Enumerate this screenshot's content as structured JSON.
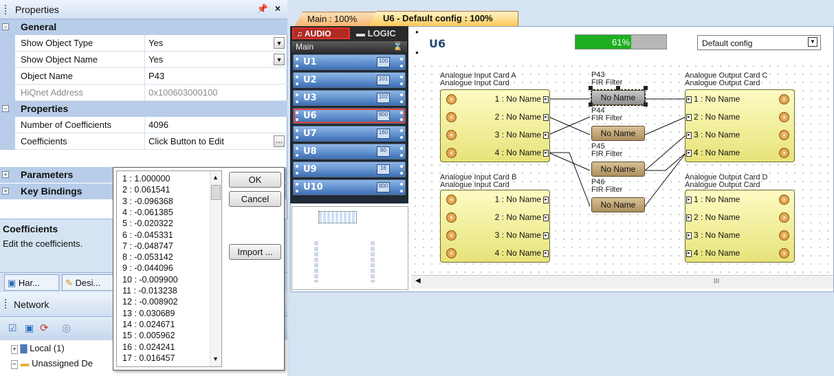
{
  "properties_panel": {
    "title": "Properties",
    "pin_glyph": "ѱ",
    "close_glyph": "×",
    "categories": {
      "general": "General",
      "properties": "Properties",
      "parameters": "Parameters",
      "key_bindings": "Key Bindings"
    },
    "rows": {
      "show_object_type": {
        "label": "Show Object Type",
        "value": "Yes"
      },
      "show_object_name": {
        "label": "Show Object Name",
        "value": "Yes"
      },
      "object_name": {
        "label": "Object Name",
        "value": "P43"
      },
      "hiqnet_address": {
        "label": "HiQnet Address",
        "value": "0x100603000100"
      },
      "num_coefficients": {
        "label": "Number of Coefficients",
        "value": "4096"
      },
      "coefficients": {
        "label": "Coefficients",
        "value": "Click Button to Edit",
        "button": "..."
      }
    },
    "description": {
      "title": "Coefficients",
      "text": "Edit the coefficients."
    },
    "tabs": [
      "Har...",
      "Desi..."
    ]
  },
  "network_panel": {
    "title": "Network",
    "tree": [
      "Local (1)",
      "Unassigned De"
    ]
  },
  "coefficients_popup": {
    "items": [
      "1 : 1.000000",
      "2 : 0.061541",
      "3 : -0.096368",
      "4 : -0.061385",
      "5 : -0.020322",
      "6 : -0.045331",
      "7 : -0.048747",
      "8 : -0.053142",
      "9 : -0.044096",
      "10 : -0.009900",
      "11 : -0.013238",
      "12 : -0.008902",
      "13 : 0.030689",
      "14 : 0.024671",
      "15 : 0.005962",
      "16 : 0.024241",
      "17 : 0.016457"
    ],
    "ok": "OK",
    "cancel": "Cancel",
    "import": "Import ..."
  },
  "document_tabs": [
    "Main : 100%",
    "U6 - Default config : 100%"
  ],
  "device_panel": {
    "audio": "AUDIO",
    "logic": "LOGIC",
    "main": "Main",
    "devices": [
      {
        "name": "U1",
        "badge": "100"
      },
      {
        "name": "U2",
        "badge": "101"
      },
      {
        "name": "U3",
        "badge": "102"
      },
      {
        "name": "U6",
        "badge": "800"
      },
      {
        "name": "U7",
        "badge": "160"
      },
      {
        "name": "U8",
        "badge": "80"
      },
      {
        "name": "U9",
        "badge": "16"
      },
      {
        "name": "U10",
        "badge": "800"
      }
    ]
  },
  "designer": {
    "device": "U6",
    "progress": "61%",
    "progress_value": 0.61,
    "config": "Default config",
    "scroll_label": "III",
    "input_a": {
      "title": "Analogue Input Card A",
      "type": "Analogue Input Card",
      "ports": [
        "1 : No Name",
        "2 : No Name",
        "3 : No Name",
        "4 : No Name"
      ]
    },
    "input_b": {
      "title": "Analogue Input Card B",
      "type": "Analogue Input Card",
      "ports": [
        "1 : No Name",
        "2 : No Name",
        "3 : No Name",
        "4 : No Name"
      ]
    },
    "output_c": {
      "title": "Analogue Output Card C",
      "type": "Analogue Output Card",
      "ports": [
        "1 : No Name",
        "2 : No Name",
        "3 : No Name",
        "4 : No Name"
      ]
    },
    "output_d": {
      "title": "Analogue Output Card D",
      "type": "Analogue Output Card",
      "ports": [
        "1 : No Name",
        "2 : No Name",
        "3 : No Name",
        "4 : No Name"
      ]
    },
    "firs": [
      {
        "id": "P43",
        "type": "FIR Filter",
        "name": "No Name"
      },
      {
        "id": "P44",
        "type": "FIR Filter",
        "name": "No Name"
      },
      {
        "id": "P45",
        "type": "FIR Filter",
        "name": "No Name"
      },
      {
        "id": "P46",
        "type": "FIR Filter",
        "name": "No Name"
      }
    ]
  },
  "colors": {
    "accent": "#3c6fb4",
    "progress": "#1fae1f",
    "card": "#e7e37a",
    "fir": "#ad8f5e"
  }
}
